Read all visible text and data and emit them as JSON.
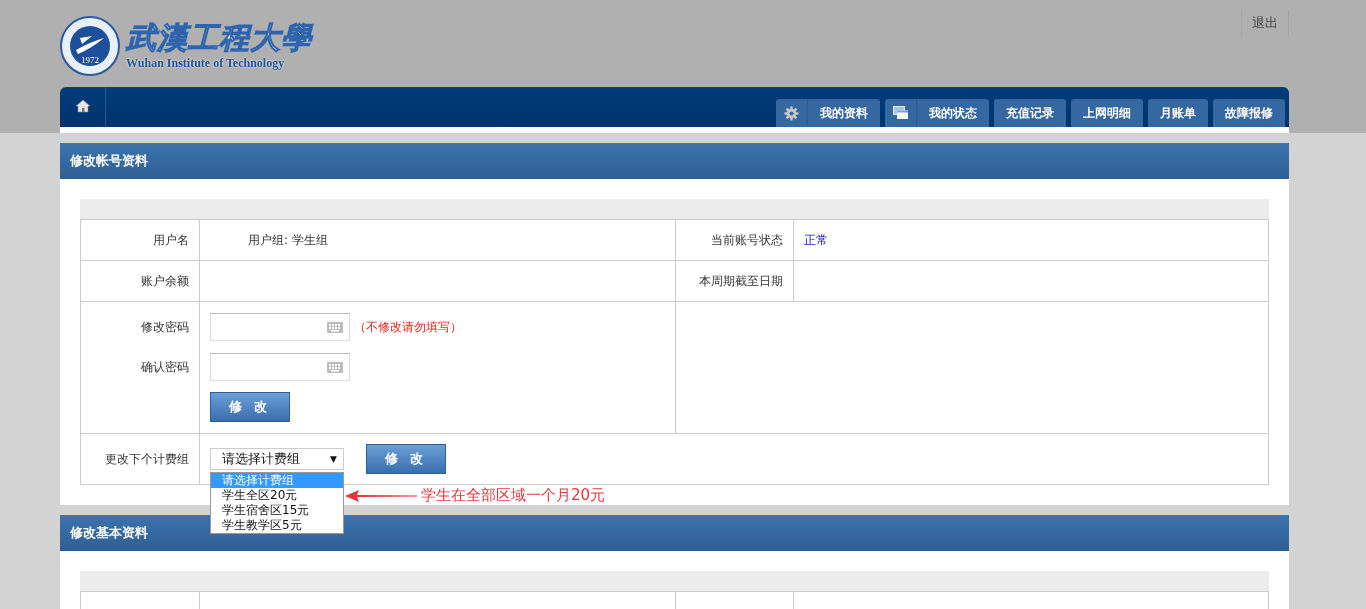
{
  "header": {
    "logo_text": "武漢工程大學",
    "logo_subtitle": "Wuhan Institute of Technology",
    "logo_year": "1972",
    "logout": "退出"
  },
  "nav": {
    "tabs": [
      {
        "label": "我的资料"
      },
      {
        "label": "我的状态"
      },
      {
        "label": "充值记录"
      },
      {
        "label": "上网明细"
      },
      {
        "label": "月账单"
      },
      {
        "label": "故障报修"
      }
    ]
  },
  "account_panel": {
    "title": "修改帐号资料",
    "user_label": "用户名",
    "group_text": "用户组: 学生组",
    "status_label": "当前账号状态",
    "status_value": "正常",
    "balance_label": "账户余额",
    "period_label": "本周期截至日期",
    "password_label": "修改密码",
    "password_hint": "（不修改请勿填写）",
    "confirm_label": "确认密码",
    "password_submit": "修 改",
    "billing_label": "更改下个计费组",
    "billing_value": "请选择计费组",
    "billing_arrow": "▼",
    "billing_options": [
      {
        "label": "请选择计费组",
        "selected": true
      },
      {
        "label": "学生全区20元",
        "selected": false
      },
      {
        "label": "学生宿舍区15元",
        "selected": false
      },
      {
        "label": "学生教学区5元",
        "selected": false
      }
    ],
    "billing_submit": "修 改"
  },
  "annotation": {
    "text": "学生在全部区域一个月20元"
  },
  "basic_panel": {
    "title": "修改基本资料"
  }
}
